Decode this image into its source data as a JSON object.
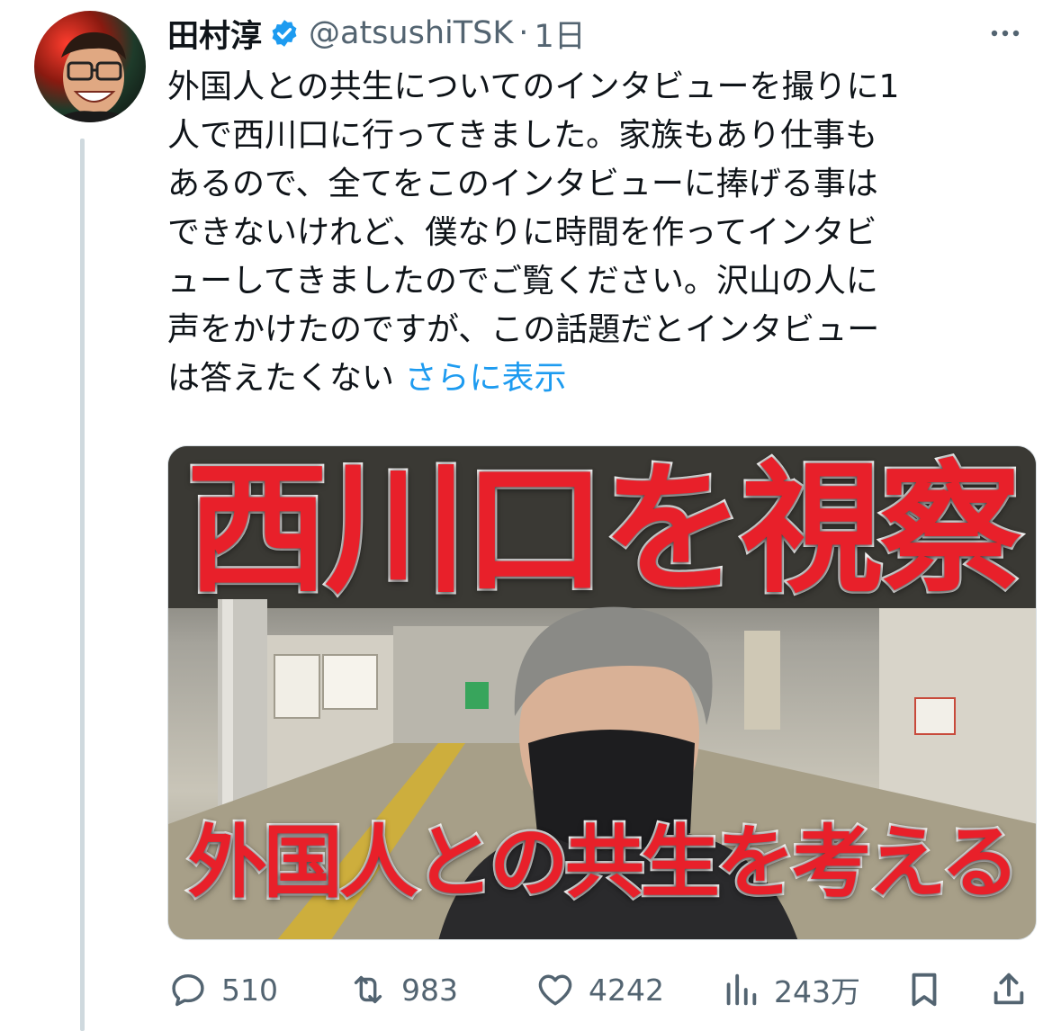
{
  "user": {
    "display_name": "田村淳",
    "handle": "@atsushiTSK",
    "separator": "·",
    "time": "1日",
    "verified": true,
    "avatar_icon": "profile-photo"
  },
  "tweet": {
    "lines": [
      "外国人との共生についてのインタビューを撮りに1",
      "人で西川口に行ってきました。家族もあり仕事も",
      "あるので、全てをこのインタビューに捧げる事は",
      "できないけれど、僕なりに時間を作ってインタビ",
      "ューしてきましたのでご覧ください。沢山の人に",
      "声をかけたのですが、この話題だとインタビュー",
      "は答えたくない"
    ],
    "show_more": "さらに表示"
  },
  "media": {
    "thumbnail_title": "西川口を視察",
    "thumbnail_subtitle": "外国人との共生を考える"
  },
  "actions": {
    "replies": "510",
    "retweets": "983",
    "likes": "4242",
    "views": "243万"
  },
  "colors": {
    "accent": "#1d9bf0",
    "muted": "#536471",
    "thumbnail_text": "#e8202a",
    "thread_line": "#cfd9de"
  }
}
